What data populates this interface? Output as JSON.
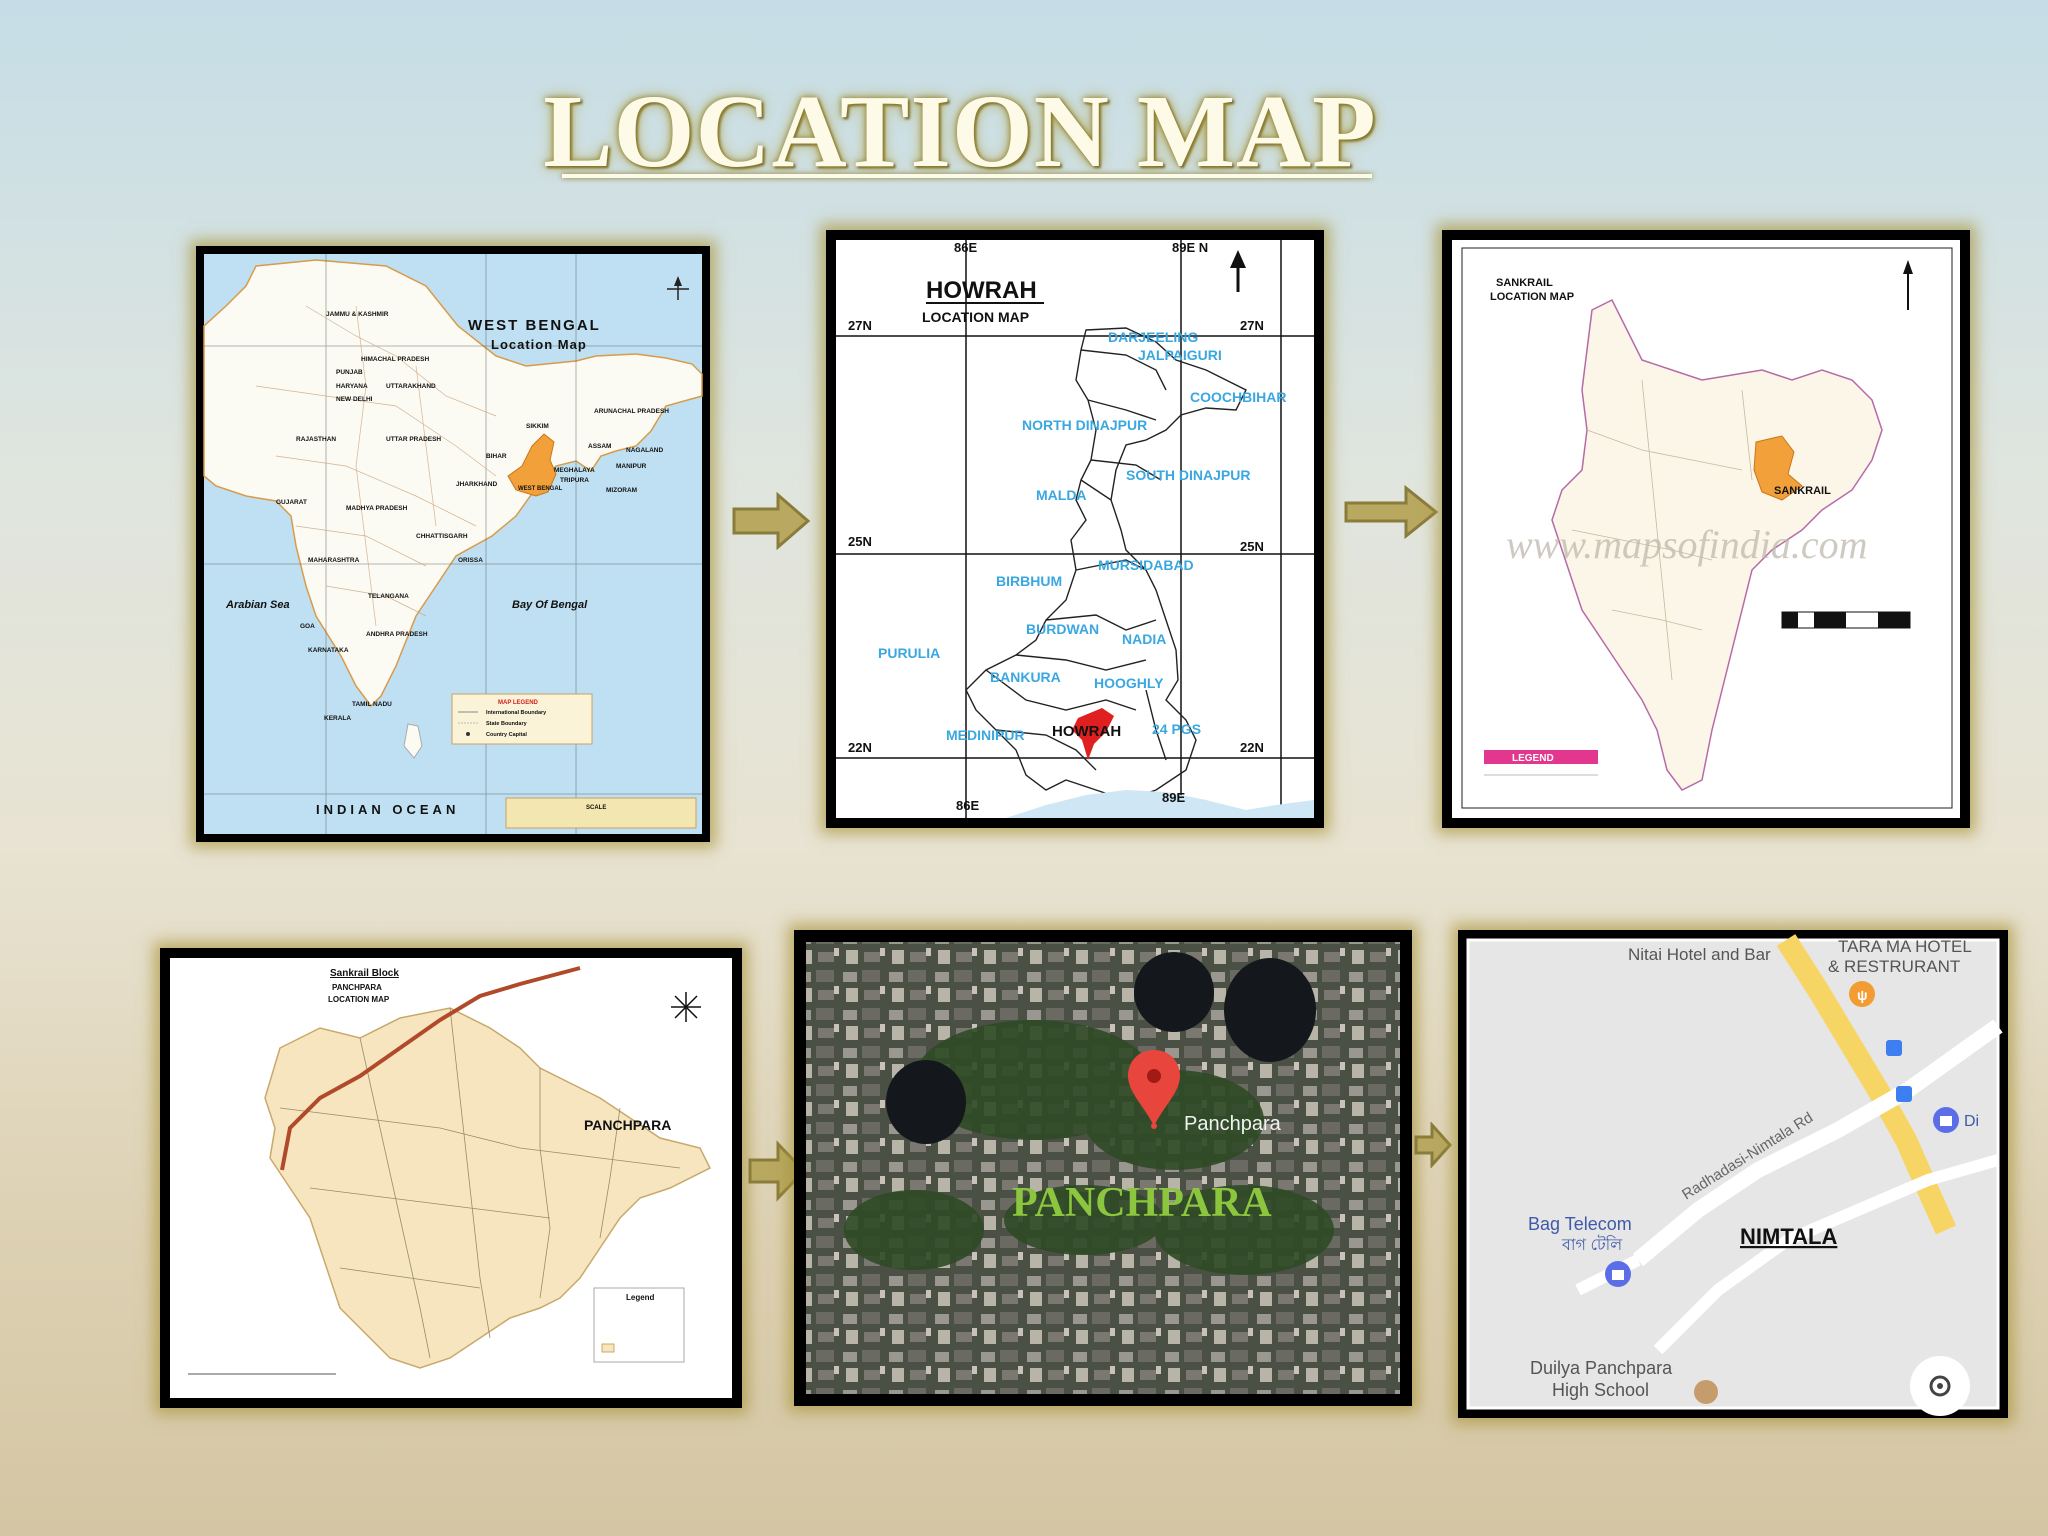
{
  "slide": {
    "title": "LOCATION MAP"
  },
  "map1": {
    "title": "WEST BENGAL",
    "subtitle": "Location Map",
    "labels": {
      "arabian_sea": "Arabian Sea",
      "bay_of_bengal": "Bay Of Bengal",
      "indian_ocean": "INDIAN OCEAN",
      "state": "WEST BENGAL"
    },
    "states": [
      "JAMMU & KASHMIR",
      "HIMACHAL PRADESH",
      "PUNJAB",
      "HARYANA",
      "UTTARAKHAND",
      "NEW DELHI",
      "RAJASTHAN",
      "UTTAR PRADESH",
      "BIHAR",
      "SIKKIM",
      "ASSAM",
      "ARUNACHAL PRADESH",
      "NAGALAND",
      "MANIPUR",
      "MIZORAM",
      "TRIPURA",
      "MEGHALAYA",
      "GUJARAT",
      "MADHYA PRADESH",
      "JHARKHAND",
      "CHHATTISGARH",
      "ORISSA",
      "MAHARASHTRA",
      "TELANGANA",
      "ANDHRA PRADESH",
      "GOA",
      "KARNATAKA",
      "KERALA",
      "TAMIL NADU"
    ],
    "legend": {
      "title": "MAP LEGEND",
      "items": [
        "International Boundary",
        "State Boundary",
        "Country Capital"
      ]
    },
    "scale": "SCALE"
  },
  "map2": {
    "title": "HOWRAH",
    "subtitle": "LOCATION MAP",
    "lon_labels": [
      "86E",
      "89E N",
      "86E",
      "89E"
    ],
    "lat_labels": [
      "27N",
      "27N",
      "25N",
      "25N",
      "22N",
      "22N"
    ],
    "districts": [
      "DARJEELING",
      "JALPAIGURI",
      "COOCHBIHAR",
      "NORTH DINAJPUR",
      "SOUTH DINAJPUR",
      "MALDA",
      "MURSIDABAD",
      "BIRBHUM",
      "BURDWAN",
      "NADIA",
      "PURULIA",
      "BANKURA",
      "HOOGHLY",
      "MEDINIPUR",
      "HOWRAH",
      "24 PGS"
    ]
  },
  "map3": {
    "title": "SANKRAIL",
    "subtitle": "LOCATION MAP",
    "highlight": "SANKRAIL",
    "watermark": "www.mapsofindia.com",
    "legend": "LEGEND"
  },
  "map4": {
    "block": "Sankrail Block",
    "title": "PANCHPARA",
    "subtitle": "LOCATION MAP",
    "highlight": "PANCHPARA",
    "legend": "Legend"
  },
  "map5": {
    "pin_label": "Panchpara",
    "caption": "PANCHPARA"
  },
  "map6": {
    "places": {
      "hotel": "Nitai Hotel and Bar",
      "restaurant_1": "TARA MA HOTEL",
      "restaurant_2": "& RESTRURANT",
      "road": "Radhadasi-Nimtala Rd",
      "telecom": "Bag Telecom",
      "telecom_bn": "বাগ টেলি",
      "school_1": "Duilya Panchpara",
      "school_2": "High School",
      "area": "NIMTALA",
      "edge": "Di"
    }
  },
  "colors": {
    "title_glow": "#b8a84a",
    "arrow": "#b8a860",
    "highlight_orange": "#f2a03a",
    "howrah_red": "#e02020",
    "district_blue": "#3aa7e0",
    "panchpara_green": "#8cc63e"
  }
}
